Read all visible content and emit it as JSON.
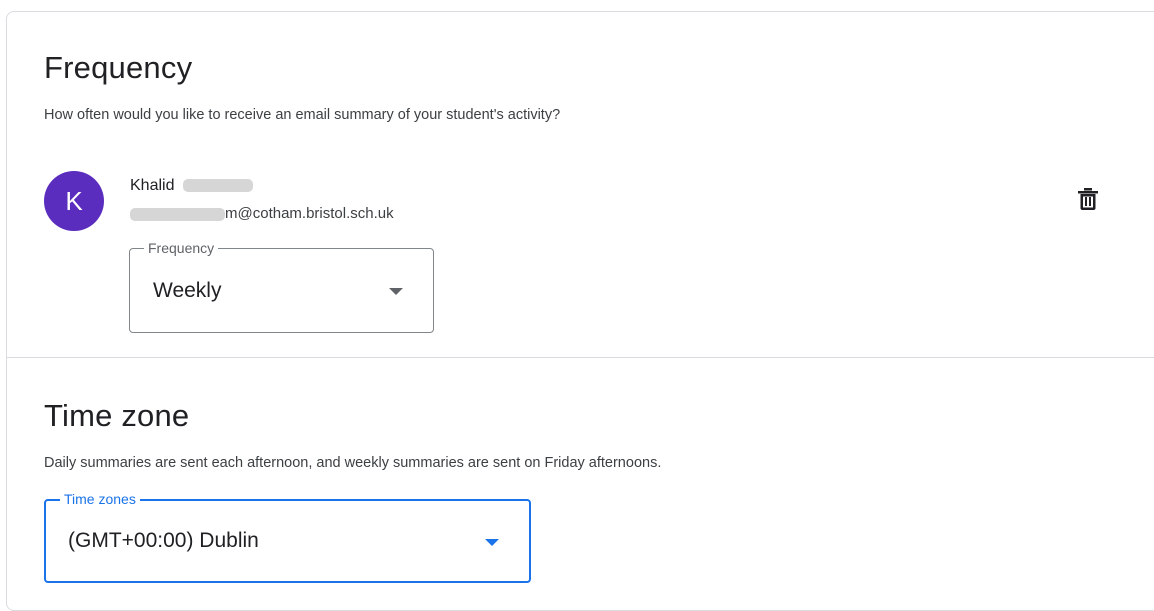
{
  "frequency_section": {
    "title": "Frequency",
    "description": "How often would you like to receive an email summary of your student's activity?",
    "guardian": {
      "avatar_initial": "K",
      "avatar_color": "#5b2dbf",
      "name": "Khalid",
      "email_suffix": "m@cotham.bristol.sch.uk"
    },
    "frequency_select": {
      "label": "Frequency",
      "value": "Weekly"
    },
    "delete_icon": "trash-icon"
  },
  "timezone_section": {
    "title": "Time zone",
    "description": "Daily summaries are sent each afternoon, and weekly summaries are sent on Friday afternoons.",
    "timezone_select": {
      "label": "Time zones",
      "value": "(GMT+00:00) Dublin",
      "accent": "#1a73e8"
    }
  }
}
